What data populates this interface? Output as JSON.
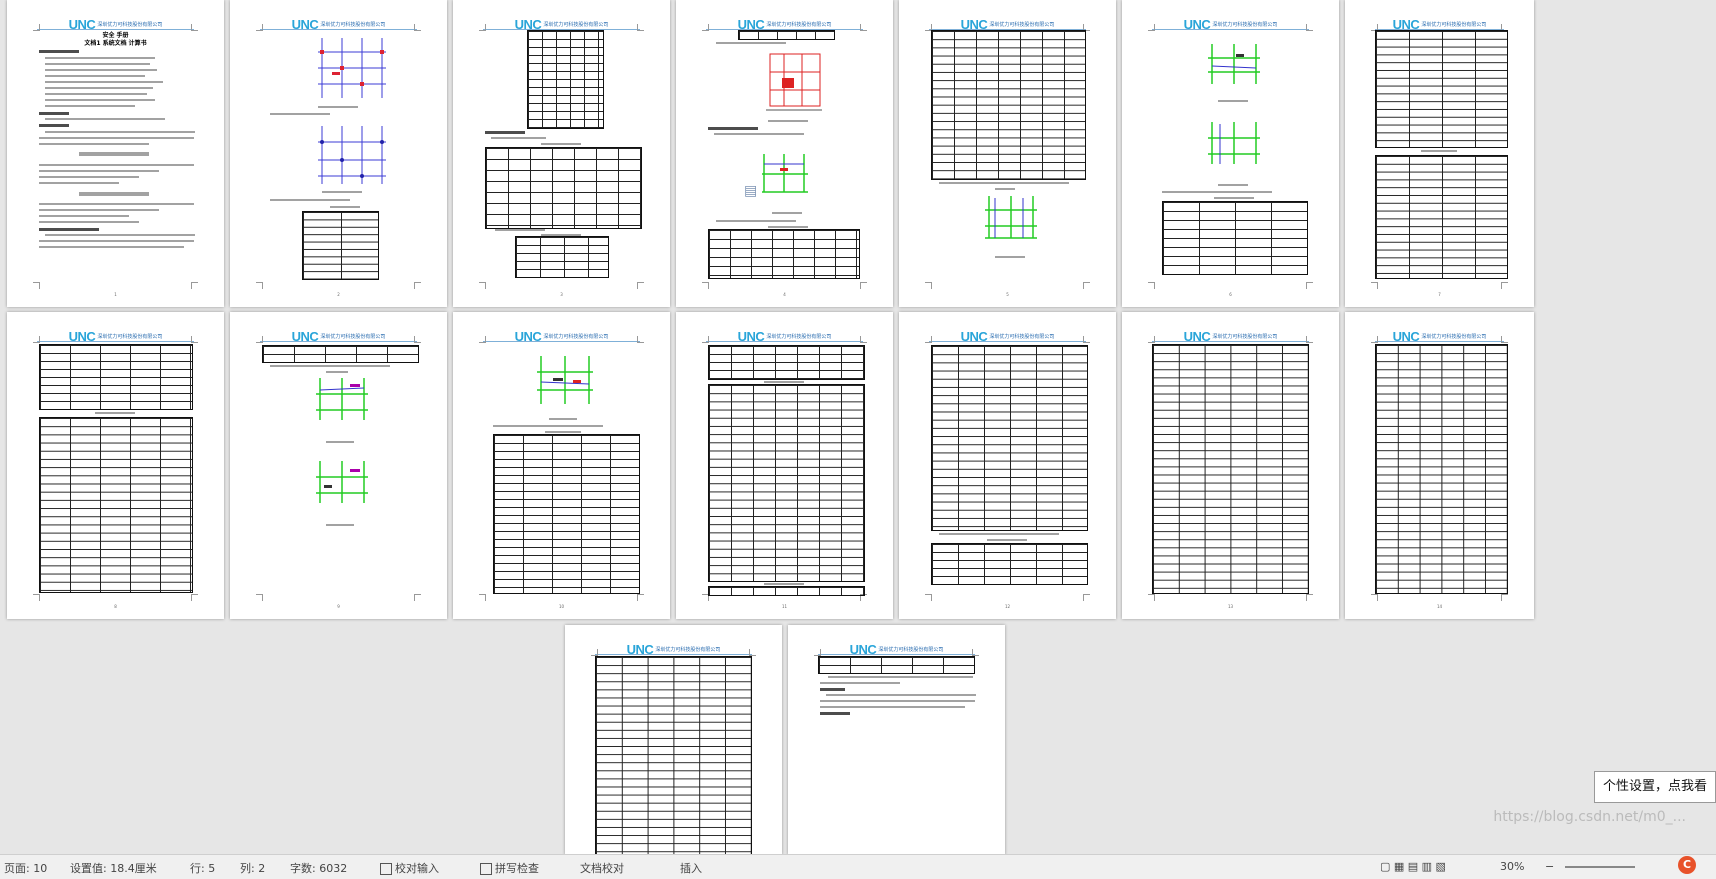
{
  "header": {
    "logo": "UNC",
    "company_cn": "深圳优力可科技股份有限公司"
  },
  "page1": {
    "title_lines": [
      "安全 手册",
      "文档1 系统文档 计算书"
    ]
  },
  "watermark": "https://blog.csdn.net/m0_...",
  "tooltip": "个性设置，点我看",
  "statusbar": {
    "items": [
      "页面: 10",
      "设置值: 18.4厘米",
      "行: 5",
      "列: 2",
      "字数: 6032",
      "校对输入",
      "拼写检查",
      "文档校对",
      "插入"
    ],
    "zoom": "30%"
  },
  "icons": {
    "doc_float": "document-icon",
    "csdn": "csdn-logo-icon"
  },
  "page_count": 16
}
